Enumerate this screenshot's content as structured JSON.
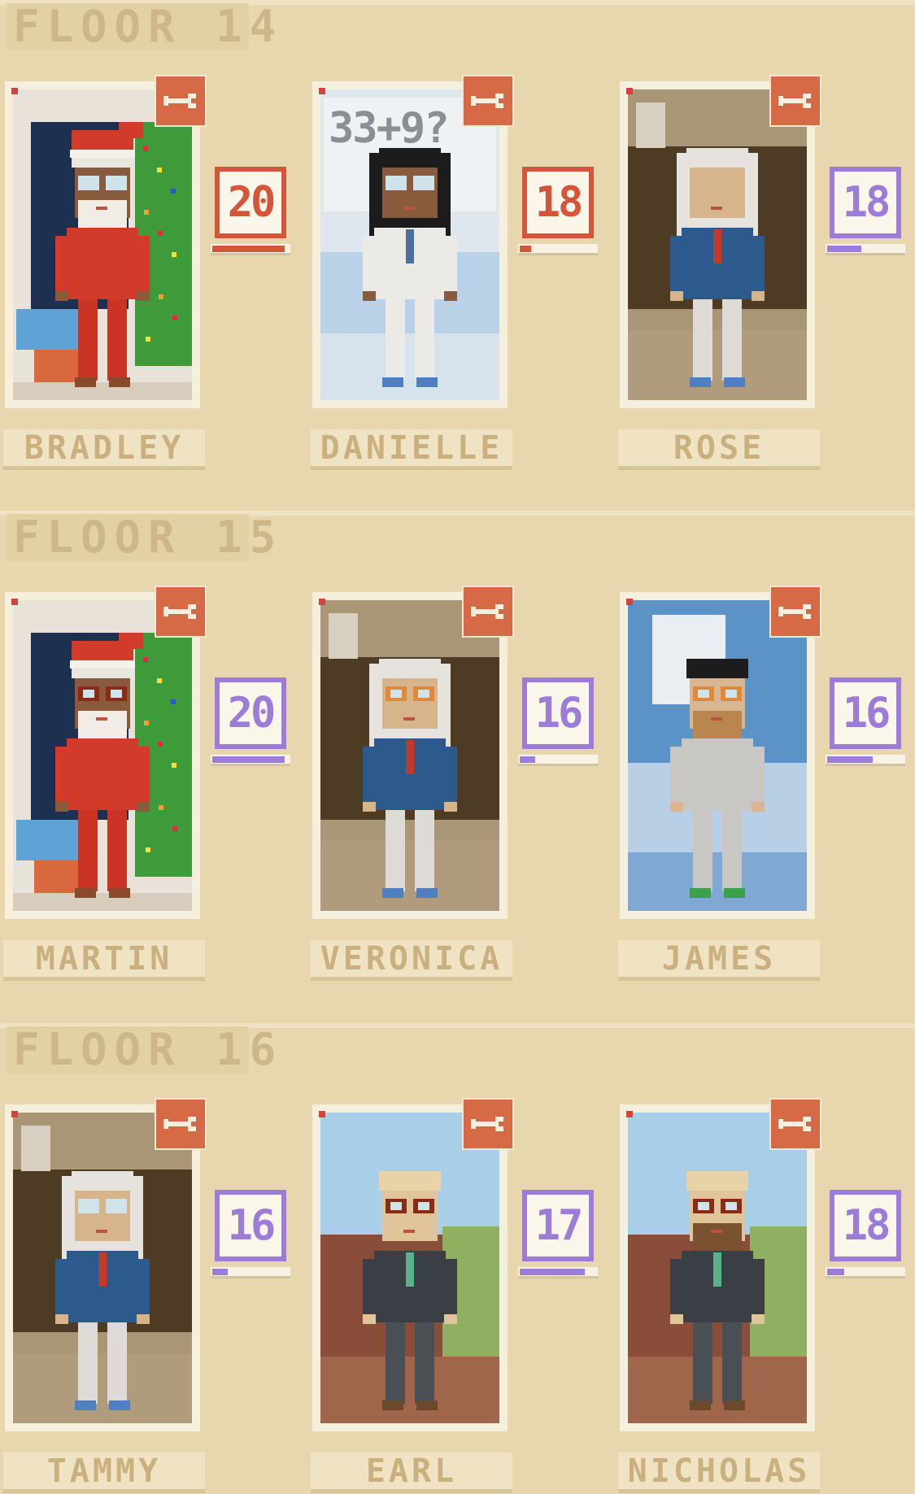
{
  "floors": [
    {
      "title": "FLOOR 14",
      "residents": [
        {
          "name": "BRADLEY",
          "level": "20",
          "progress": 0.95,
          "color": "red",
          "scene": "xmas"
        },
        {
          "name": "DANIELLE",
          "level": "18",
          "progress": 0.15,
          "color": "red",
          "scene": "lab",
          "board_text": "33+9?"
        },
        {
          "name": "ROSE",
          "level": "18",
          "progress": 0.45,
          "color": "purple",
          "scene": "office"
        }
      ]
    },
    {
      "title": "FLOOR 15",
      "residents": [
        {
          "name": "MARTIN",
          "level": "20",
          "progress": 0.95,
          "color": "purple",
          "scene": "xmas"
        },
        {
          "name": "VERONICA",
          "level": "16",
          "progress": 0.2,
          "color": "purple",
          "scene": "office"
        },
        {
          "name": "JAMES",
          "level": "16",
          "progress": 0.6,
          "color": "purple",
          "scene": "clinic"
        }
      ]
    },
    {
      "title": "FLOOR 16",
      "residents": [
        {
          "name": "TAMMY",
          "level": "16",
          "progress": 0.2,
          "color": "purple",
          "scene": "office"
        },
        {
          "name": "EARL",
          "level": "17",
          "progress": 0.85,
          "color": "purple",
          "scene": "outdoor"
        },
        {
          "name": "NICHOLAS",
          "level": "18",
          "progress": 0.22,
          "color": "purple",
          "scene": "outdoor"
        }
      ]
    }
  ],
  "icons": {
    "edit": "wrench-icon"
  },
  "colors": {
    "background": "#e8d7ae",
    "accent_red": "#d4553a",
    "accent_purple": "#9b7cd8",
    "wrench": "#d66a47"
  }
}
